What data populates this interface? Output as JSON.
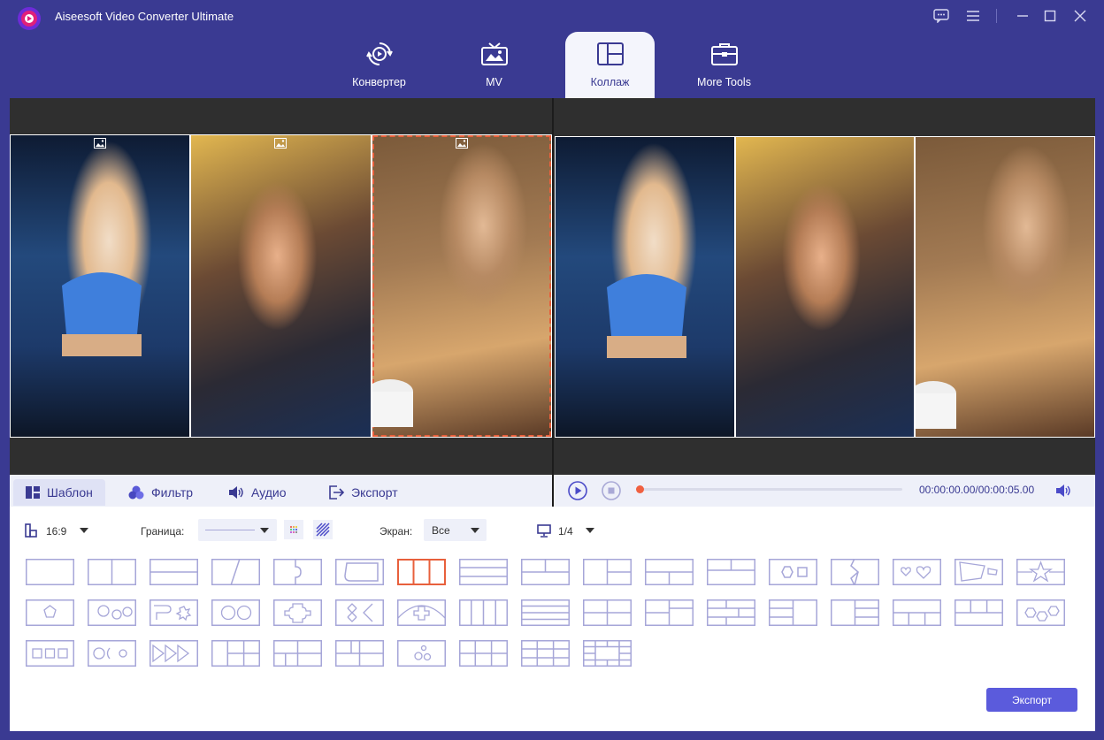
{
  "app": {
    "title": "Aiseesoft Video Converter Ultimate"
  },
  "tabs": [
    {
      "label": "Конвертер",
      "icon": "convert-icon"
    },
    {
      "label": "MV",
      "icon": "mv-icon"
    },
    {
      "label": "Коллаж",
      "icon": "collage-icon",
      "active": true
    },
    {
      "label": "More Tools",
      "icon": "toolbox-icon"
    }
  ],
  "subtabs": [
    {
      "label": "Шаблон",
      "icon": "template-icon",
      "active": true
    },
    {
      "label": "Фильтр",
      "icon": "filter-icon"
    },
    {
      "label": "Аудио",
      "icon": "speaker-icon"
    },
    {
      "label": "Экспорт",
      "icon": "export-icon"
    }
  ],
  "player": {
    "time": "00:00:00.00/00:00:05.00",
    "progress": 0.0
  },
  "options": {
    "aspect": "16:9",
    "border_label": "Граница:",
    "screen_label": "Экран:",
    "screen_value": "Все",
    "monitor_value": "1/4"
  },
  "export_label": "Экспорт",
  "colors": {
    "accent": "#3a3a92",
    "button": "#5b5bdc",
    "selection": "#e8603c",
    "template": "#a6a6d8"
  }
}
